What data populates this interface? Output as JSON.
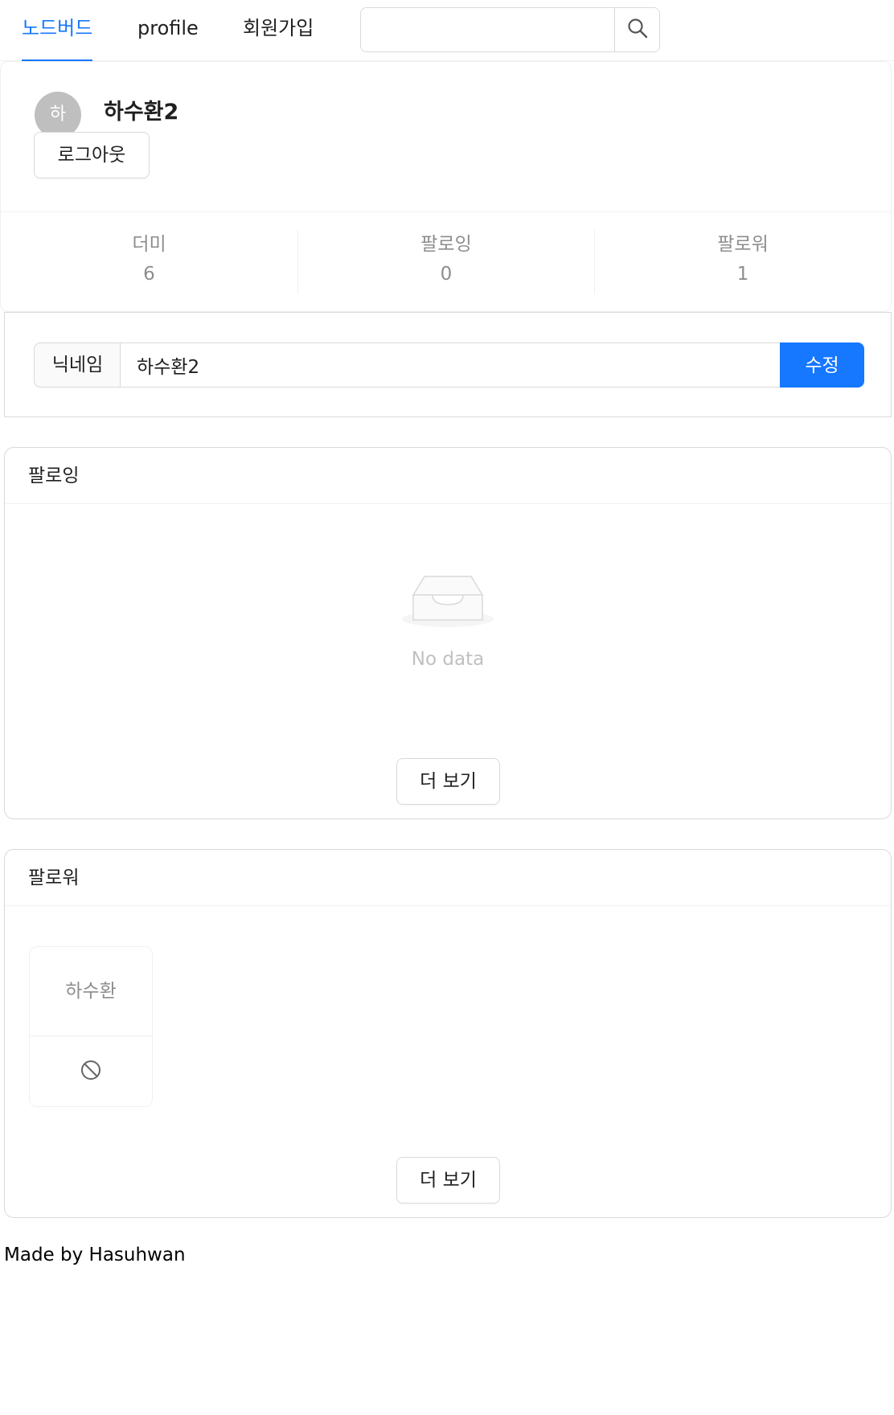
{
  "nav": {
    "items": [
      {
        "label": "노드버드",
        "active": true
      },
      {
        "label": "profile",
        "active": false
      },
      {
        "label": "회원가입",
        "active": false
      }
    ],
    "search": {
      "placeholder": "",
      "icon": "search-icon"
    }
  },
  "profile": {
    "avatar_initial": "하",
    "username": "하수환2",
    "logout_label": "로그아웃",
    "stats": [
      {
        "label": "더미",
        "value": "6"
      },
      {
        "label": "팔로잉",
        "value": "0"
      },
      {
        "label": "팔로워",
        "value": "1"
      }
    ]
  },
  "nickname_form": {
    "addon_label": "닉네임",
    "value": "하수환2",
    "submit_label": "수정"
  },
  "following": {
    "title": "팔로잉",
    "empty_text": "No data",
    "more_label": "더 보기"
  },
  "followers": {
    "title": "팔로워",
    "items": [
      {
        "name": "하수환",
        "action_icon": "stop-icon"
      }
    ],
    "more_label": "더 보기"
  },
  "footer": {
    "text": "Made by Hasuhwan"
  },
  "colors": {
    "accent": "#1677ff",
    "border": "#d9d9d9"
  }
}
